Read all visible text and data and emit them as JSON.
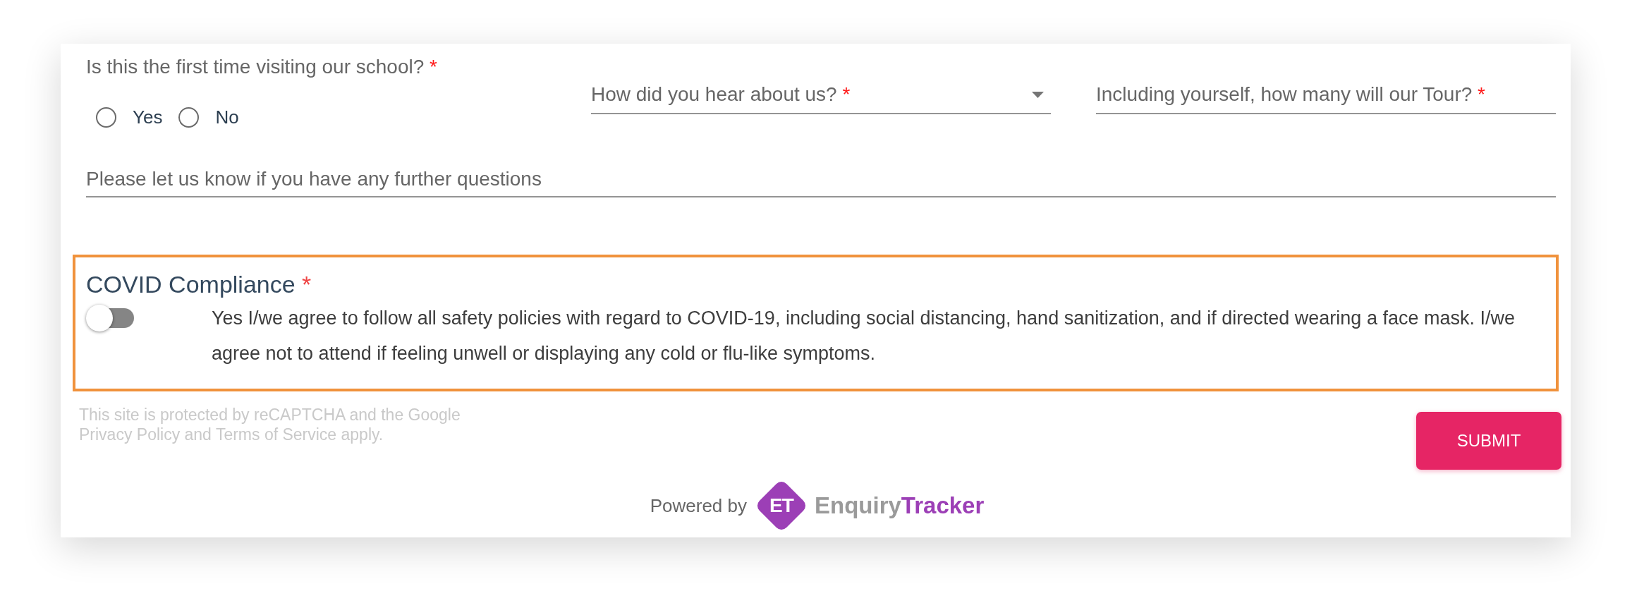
{
  "questions": {
    "first_visit": {
      "label": "Is this the first time visiting our school?",
      "required_mark": "*",
      "options": [
        {
          "label": "Yes",
          "selected": false
        },
        {
          "label": "No",
          "selected": false
        }
      ]
    },
    "hear_about": {
      "placeholder": "How did you hear about us?",
      "required_mark": "*"
    },
    "tour_size": {
      "placeholder": "Including yourself, how many will our Tour?",
      "required_mark": "*"
    },
    "further_questions": {
      "placeholder": "Please let us know if you have any further questions"
    }
  },
  "covid": {
    "title": "COVID Compliance",
    "required_mark": "*",
    "toggle": {
      "on": false
    },
    "agreement": "Yes I/we agree to follow all safety policies with regard to COVID-19, including social distancing, hand sanitization, and if directed wearing a face mask. I/we agree not to attend if feeling unwell or displaying any cold or flu-like symptoms."
  },
  "recaptcha_notice": [
    "This site is protected by reCAPTCHA and the Google",
    "Privacy Policy and Terms of Service apply."
  ],
  "submit": "SUBMIT",
  "footer": {
    "powered_by": "Powered by",
    "logo": {
      "mark": "ET",
      "name_first": "Enquiry",
      "name_second": "Tracker"
    }
  }
}
